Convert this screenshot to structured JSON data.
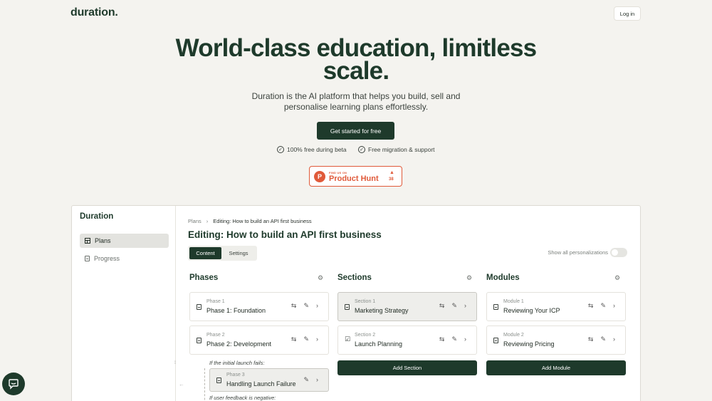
{
  "brand": {
    "logo": "duration."
  },
  "header": {
    "login_label": "Log in"
  },
  "hero": {
    "title": "World-class education, limitless scale.",
    "subtitle": "Duration is the AI platform that helps you build, sell and personalise learning plans effortlessly.",
    "cta_label": "Get started for free",
    "features": [
      "100% free during beta",
      "Free migration & support"
    ]
  },
  "product_hunt": {
    "small": "FIND US ON",
    "name": "Product Hunt",
    "count": "38"
  },
  "app": {
    "sidebar": {
      "title": "Duration",
      "items": [
        {
          "label": "Plans",
          "icon": "grid-icon"
        },
        {
          "label": "Progress",
          "icon": "document-icon"
        }
      ]
    },
    "breadcrumb": {
      "root": "Plans",
      "separator": "›",
      "current": "Editing: How to build an API first business"
    },
    "page_title": "Editing: How to build an API first business",
    "tabs": [
      "Content",
      "Settings"
    ],
    "personalizations_label": "Show all personalizations",
    "columns": {
      "phases": {
        "title": "Phases",
        "cards": [
          {
            "kicker": "Phase 1",
            "title": "Phase 1: Foundation"
          },
          {
            "kicker": "Phase 2",
            "title": "Phase 2: Development"
          }
        ],
        "condition_1": "If the initial launch fails:",
        "branch_card": {
          "kicker": "Phase 3",
          "title": "Handling Launch Failure"
        },
        "condition_2": "If user feedback is negative:"
      },
      "sections": {
        "title": "Sections",
        "cards": [
          {
            "kicker": "Section 1",
            "title": "Marketing Strategy"
          },
          {
            "kicker": "Section 2",
            "title": "Launch Planning"
          }
        ],
        "add_label": "Add Section"
      },
      "modules": {
        "title": "Modules",
        "cards": [
          {
            "kicker": "Module 1",
            "title": "Reviewing Your ICP"
          },
          {
            "kicker": "Module 2",
            "title": "Reviewing Pricing"
          }
        ],
        "add_label": "Add Module"
      }
    }
  },
  "colors": {
    "brand": "#1e3a2b",
    "background": "#f4f3ef",
    "product_hunt": "#e05a3a"
  }
}
